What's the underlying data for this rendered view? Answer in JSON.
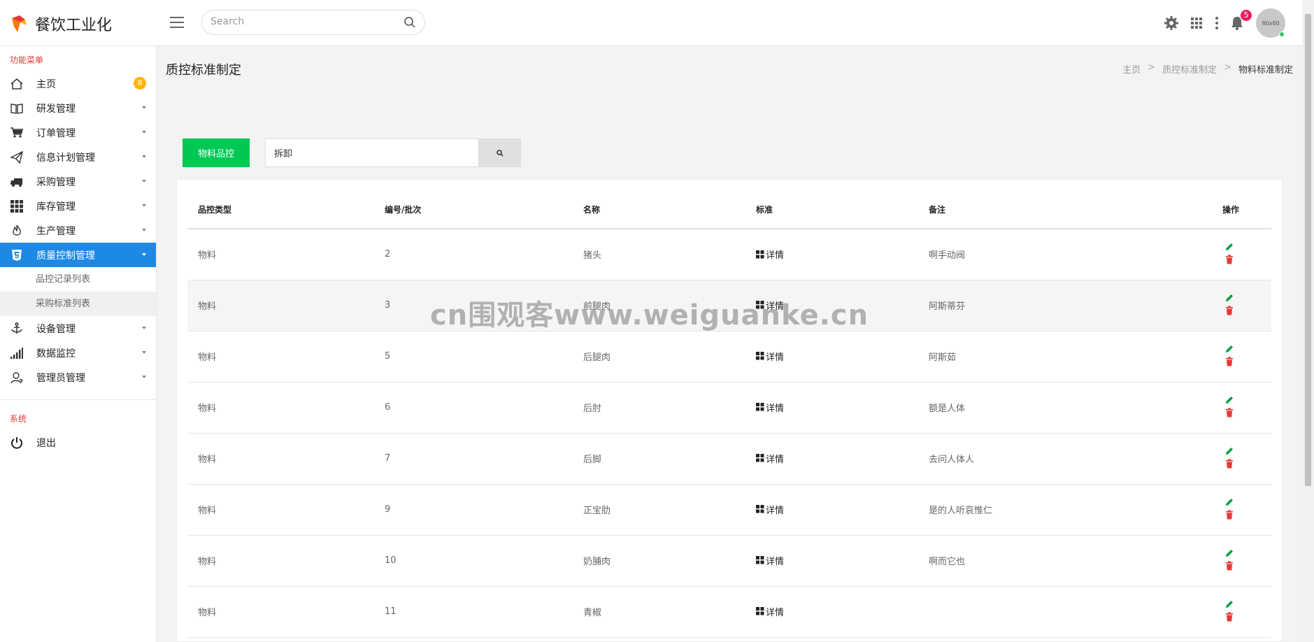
{
  "brand": {
    "name": "餐饮工业化",
    "logo_icon": "flame-logo-icon"
  },
  "topbar": {
    "search_placeholder": "Search",
    "notifications_count": "5",
    "avatar_text": "80x80"
  },
  "sidebar": {
    "section_menu": "功能菜单",
    "items": [
      {
        "label": "主页",
        "icon": "home-icon",
        "badge": "8"
      },
      {
        "label": "研发管理",
        "icon": "book-icon"
      },
      {
        "label": "订单管理",
        "icon": "cart-icon"
      },
      {
        "label": "信息计划管理",
        "icon": "paper-plane-icon"
      },
      {
        "label": "采购管理",
        "icon": "truck-icon"
      },
      {
        "label": "库存管理",
        "icon": "grid-icon"
      },
      {
        "label": "生产管理",
        "icon": "fire-icon"
      },
      {
        "label": "质量控制管理",
        "icon": "html5-icon",
        "active": true
      },
      {
        "label": "设备管理",
        "icon": "anchor-icon"
      },
      {
        "label": "数据监控",
        "icon": "signal-icon"
      },
      {
        "label": "管理员管理",
        "icon": "user-icon"
      }
    ],
    "sub_items": [
      {
        "label": "品控记录列表"
      },
      {
        "label": "采购标准列表"
      }
    ],
    "section_system": "系统",
    "logout": "退出"
  },
  "page": {
    "title": "质控标准制定",
    "breadcrumb": [
      "主页",
      "质控标准制定",
      "物料标准制定"
    ]
  },
  "toolbar": {
    "button_label": "物料品控",
    "filter_value": "拆卸"
  },
  "table": {
    "headers": [
      "品控类型",
      "编号/批次",
      "名称",
      "标准",
      "备注",
      "操作"
    ],
    "detail_label": "详情",
    "rows": [
      {
        "type": "物料",
        "id": "2",
        "name": "猪头",
        "remark": "啊手动阀"
      },
      {
        "type": "物料",
        "id": "3",
        "name": "前腿肉",
        "remark": "阿斯蒂芬"
      },
      {
        "type": "物料",
        "id": "5",
        "name": "后腿肉",
        "remark": "阿斯茹"
      },
      {
        "type": "物料",
        "id": "6",
        "name": "后肘",
        "remark": "额是人体"
      },
      {
        "type": "物料",
        "id": "7",
        "name": "后脚",
        "remark": "去问人体人"
      },
      {
        "type": "物料",
        "id": "9",
        "name": "正宝肋",
        "remark": "是的人听哀惟仁"
      },
      {
        "type": "物料",
        "id": "10",
        "name": "奶脯肉",
        "remark": "啊而它也"
      },
      {
        "type": "物料",
        "id": "11",
        "name": "青椒",
        "remark": ""
      }
    ]
  },
  "watermark": "cn围观客www.weiguanke.cn",
  "colors": {
    "accent": "#1e88e5",
    "green": "#00c853",
    "red": "#e53935",
    "badge": "#ffb300"
  }
}
